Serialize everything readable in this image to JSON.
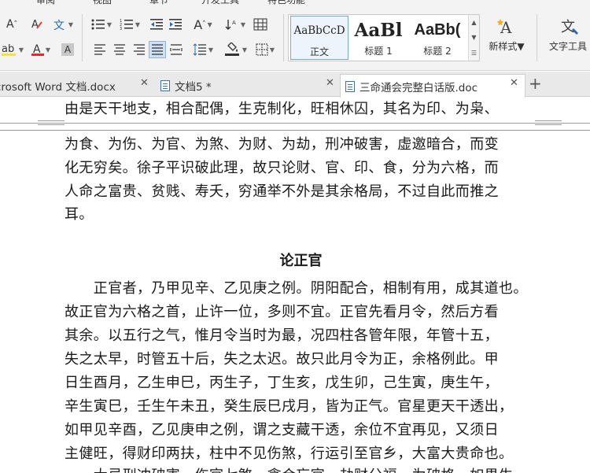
{
  "ribbon": {
    "menu_tabs": [
      "审阅",
      "视图",
      "章节",
      "开发工具",
      "特色功能"
    ],
    "styles": [
      {
        "sample": "AaBbCcD",
        "name": "正文",
        "selected": true
      },
      {
        "sample": "AaBl",
        "name": "标题 1",
        "selected": false
      },
      {
        "sample": "AaBb(",
        "name": "标题 2",
        "selected": false
      }
    ],
    "new_style_label": "新样式",
    "text_tools_label": "文字工具"
  },
  "tabs": [
    {
      "title": "crosoft Word 文档.docx",
      "active": false
    },
    {
      "title": "文档5 *",
      "active": false
    },
    {
      "title": "三命通会完整白话版.doc",
      "active": true
    }
  ],
  "document": {
    "lines_top": [
      "由是天干地支，相合配偶，生克制化，旺相休囚，其名为印、为枭、",
      "为食、为伤、为官、为煞、为财、为劫，刑冲破害，虚邀暗合，而变",
      "化无穷矣。徐子平识破此理，故只论财、官、印、食，分为六格，而",
      "人命之富贵、贫贱、寿夭，穷通举不外是其余格局，不过自此而推之",
      "耳。"
    ],
    "heading": "论正官",
    "lines_body": [
      "　　正官者，乃甲见辛、乙见庚之例。阴阳配合，相制有用，成其道也。",
      "故正官为六格之首，止许一位，多则不宜。正官先看月令，然后方看",
      "其余。以五行之气，惟月令当时为最，况四柱各管年限，年管十五，",
      "失之太早，时管五十后，失之太迟。故只此月令为正，余格例此。甲",
      "日生酉月，乙生申巳，丙生子，丁生亥，戊生卯，己生寅，庚生午，",
      "辛生寅巳，壬生午未丑，癸生辰巳戌月，皆为正气。官星更天干透出，",
      "如甲见辛酉，乙见庚申之例，谓之支藏干透，余位不宜再见，又须日",
      "主健旺，得财印两扶，柱中不见伤煞，行运引至官乡，大富大贵命也。",
      "　　大忌刑冲破害，伤官七煞，贪合忘官，劫财分福，为破格。如果生"
    ]
  }
}
